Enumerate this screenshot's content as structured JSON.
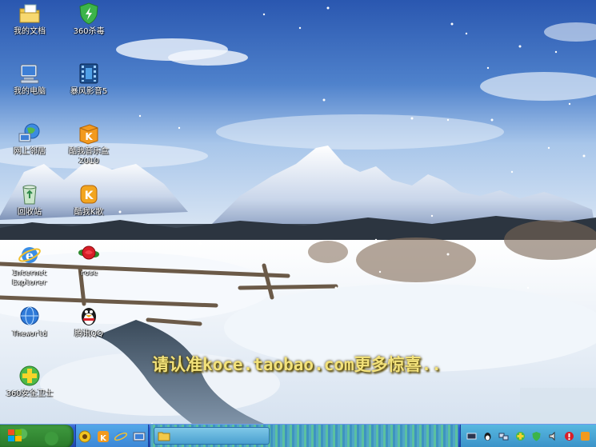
{
  "desktop": {
    "icons": [
      {
        "label": "我的文档",
        "icon": "my-documents-icon"
      },
      {
        "label": "360杀毒",
        "icon": "360-antivirus-icon"
      },
      {
        "label": "我的电脑",
        "icon": "my-computer-icon"
      },
      {
        "label": "暴风影音5",
        "icon": "baofeng-player-icon"
      },
      {
        "label": "网上邻居",
        "icon": "network-places-icon"
      },
      {
        "label": "酷我音乐盒\n2010",
        "icon": "kuwo-music-icon"
      },
      {
        "label": "回收站",
        "icon": "recycle-bin-icon"
      },
      {
        "label": "酷我K歌",
        "icon": "kuwo-karaoke-icon"
      },
      {
        "label": "Internet\nExplorer",
        "icon": "internet-explorer-icon"
      },
      {
        "label": "rose",
        "icon": "rose-icon"
      },
      {
        "label": "Theworld",
        "icon": "theworld-browser-icon"
      },
      {
        "label": "腾讯QQ",
        "icon": "qq-penguin-icon"
      },
      {
        "label": "360安全卫士",
        "icon": "360-safeguard-icon"
      }
    ]
  },
  "banner": {
    "text": "请认准koce.taobao.com更多惊喜.."
  },
  "colors": {
    "sky_top": "#2f5fb8",
    "sky_bottom": "#9cc0e8",
    "snow": "#f4f8fc",
    "banner_text": "#f3e27a",
    "taskbar": "#2a58c8",
    "start_green": "#2f8a2f"
  }
}
